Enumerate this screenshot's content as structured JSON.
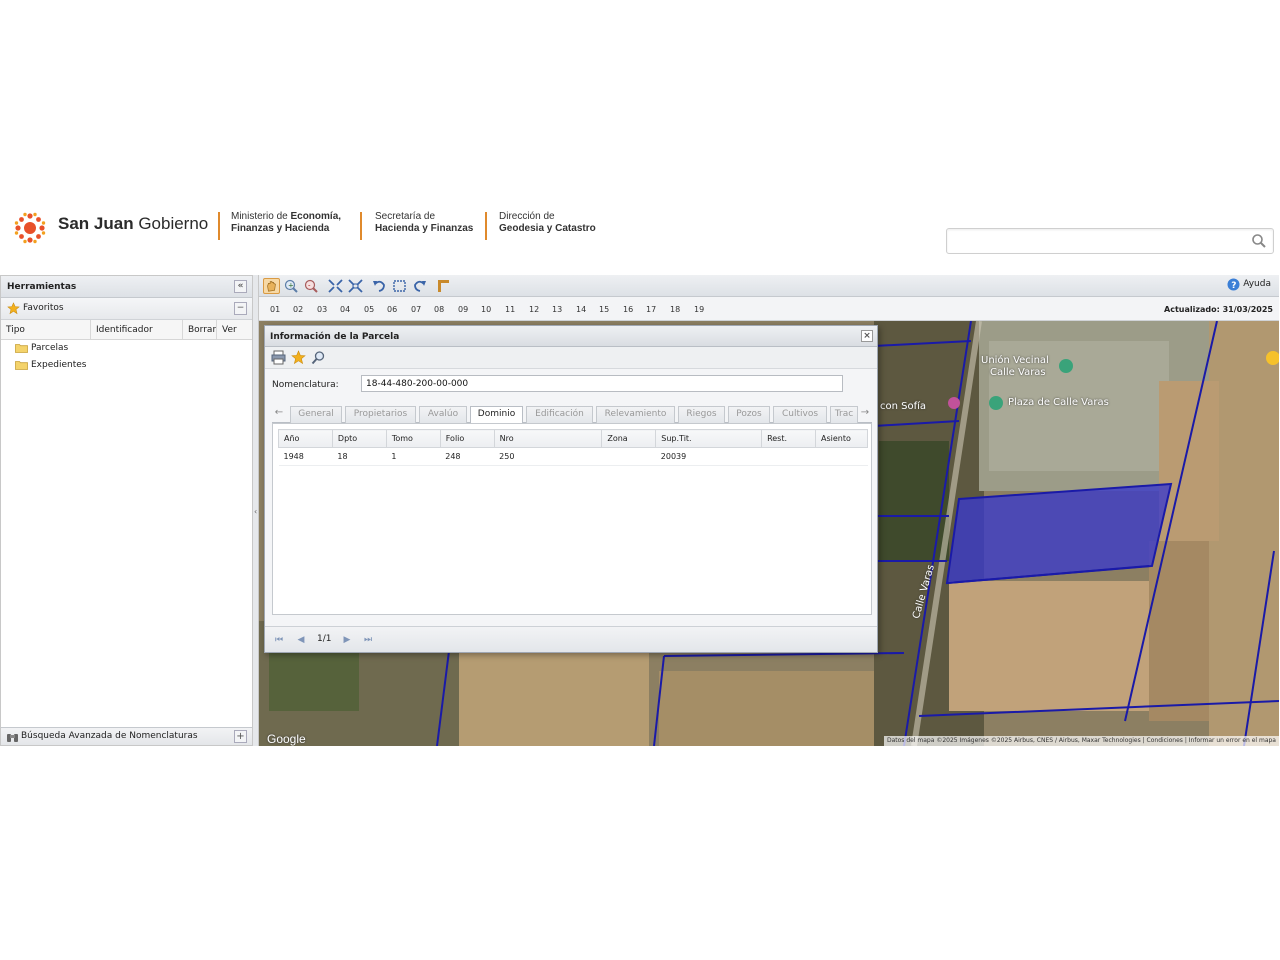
{
  "header": {
    "brand_bold": "San Juan",
    "brand_regular": " Gobierno",
    "ministry_line1_prefix": "Ministerio de ",
    "ministry_line1_bold": "Economía,",
    "ministry_line2": "Finanzas y Hacienda",
    "secretary_line1": "Secretaría de",
    "secretary_line2": "Hacienda y Finanzas",
    "direction_line1": "Dirección de",
    "direction_line2": "Geodesia y Catastro",
    "search_value": "",
    "search_placeholder": ""
  },
  "left_panel": {
    "title": "Herramientas",
    "favorites_title": "Favoritos",
    "columns": [
      "Tipo",
      "Identificador",
      "Borrar",
      "Ver"
    ],
    "tree_items": [
      "Parcelas",
      "Expedientes"
    ],
    "footer_label": "Búsqueda Avanzada de Nomenclaturas"
  },
  "toolbar": {
    "help_label": "Ayuda",
    "icons": [
      "pan-hand-icon",
      "zoom-in-icon",
      "zoom-out-icon",
      "zoom-extent-icon",
      "full-extent-icon",
      "undo-icon",
      "select-box-icon",
      "redo-icon",
      "measure-icon"
    ]
  },
  "zoom_levels": [
    "01",
    "02",
    "03",
    "04",
    "05",
    "06",
    "07",
    "08",
    "09",
    "10",
    "11",
    "12",
    "13",
    "14",
    "15",
    "16",
    "17",
    "18",
    "19"
  ],
  "updated_label": "Actualizado: 31/03/2025",
  "map": {
    "labels": {
      "union_vecinal": "Unión Vecinal",
      "calle_varas_1": "Calle Varas",
      "plaza": "Plaza de Calle Varas",
      "calle_varas_road": "Calle Varas",
      "con_sofia": "con Sofía"
    },
    "google": "Google",
    "attribution": "Datos del mapa ©2025 Imágenes ©2025 Airbus, CNES / Airbus, Maxar Technologies | Condiciones | Informar un error en el mapa"
  },
  "dialog": {
    "title": "Información de la Parcela",
    "nomenclatura_label": "Nomenclatura:",
    "nomenclatura_value": "18-44-480-200-00-000",
    "tabs": [
      "General",
      "Propietarios",
      "Avalúo",
      "Dominio",
      "Edificación",
      "Relevamiento",
      "Riegos",
      "Pozos",
      "Cultivos",
      "Trac"
    ],
    "active_tab": "Dominio",
    "columns": [
      "Año",
      "Dpto",
      "Tomo",
      "Folio",
      "Nro",
      "Zona",
      "Sup.Tit.",
      "Rest.",
      "Asiento"
    ],
    "rows": [
      [
        "1948",
        "18",
        "1",
        "248",
        "250",
        "",
        "20039",
        "",
        ""
      ]
    ],
    "page_label": "1/1"
  },
  "colors": {
    "accent_orange": "#e08a2c",
    "parcel_highlight": "#3a3acc",
    "parcel_border": "#1a1aa8"
  }
}
